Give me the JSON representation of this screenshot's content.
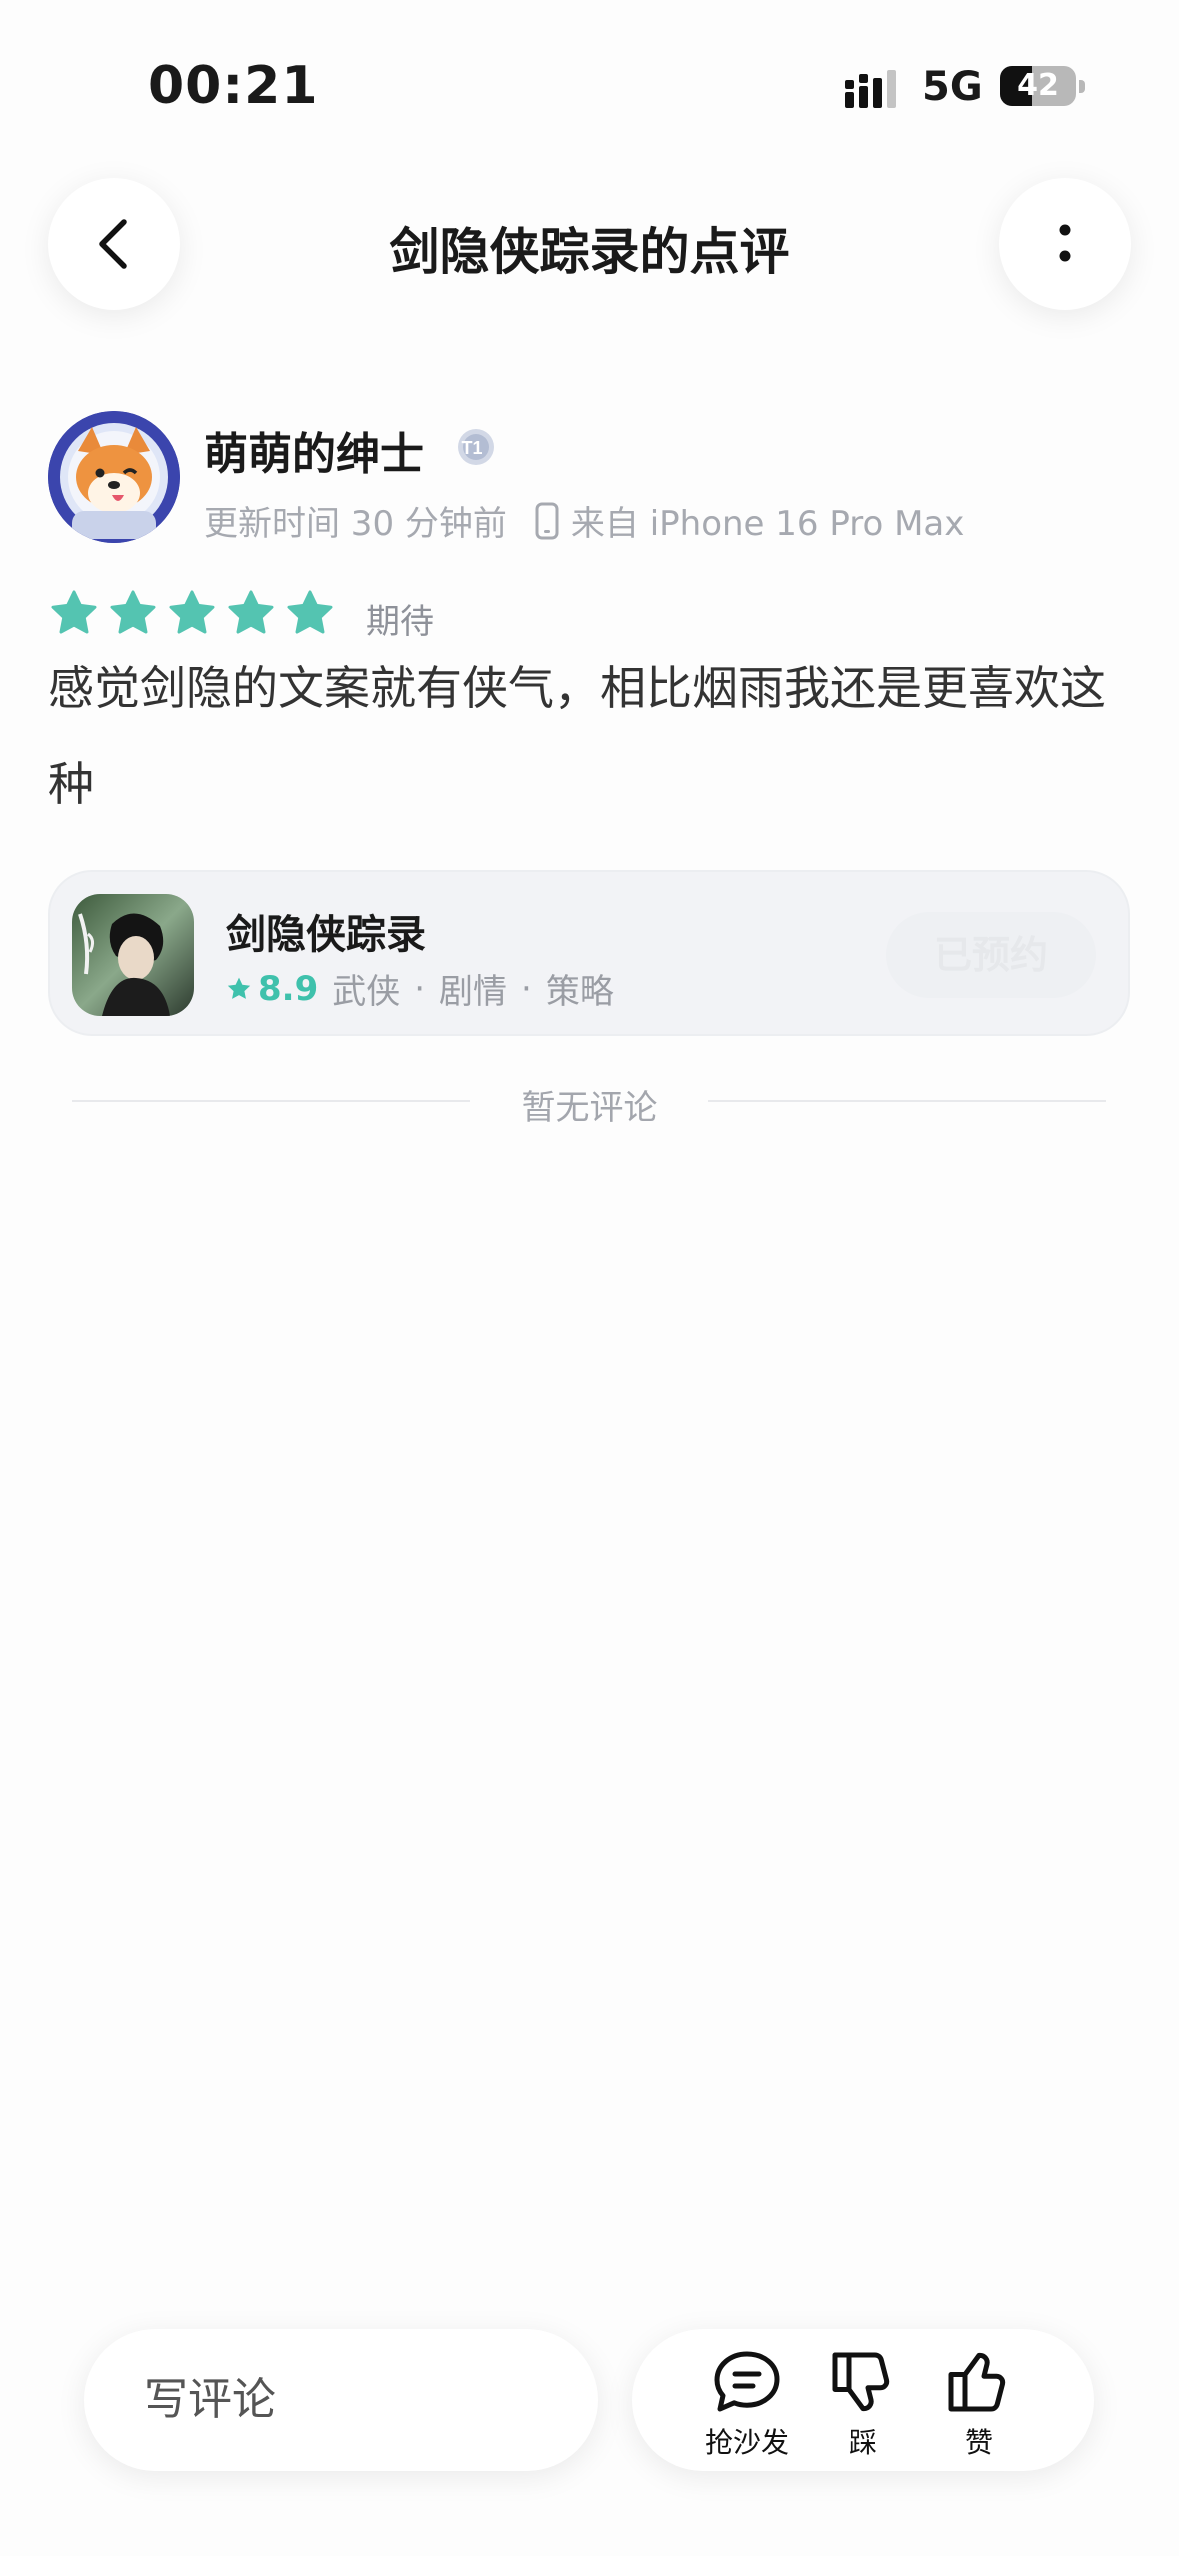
{
  "status_bar": {
    "time": "00:21",
    "network": "5G",
    "battery": "42",
    "battery_level": 0.42
  },
  "header": {
    "title": "剑隐侠踪录的点评",
    "back_icon": "chevron-left-icon",
    "more_icon": "more-vertical-icon"
  },
  "author": {
    "name": "萌萌的绅士",
    "level_badge": "T1",
    "updated": "更新时间 30 分钟前",
    "device": "来自 iPhone 16 Pro Max"
  },
  "rating": {
    "stars": 5,
    "label": "期待",
    "star_color": "#54c4b1"
  },
  "review": {
    "text": "感觉剑隐的文案就有侠气，相比烟雨我还是更喜欢这种"
  },
  "game_card": {
    "name": "剑隐侠踪录",
    "score": "8.9",
    "tags": [
      "武侠",
      "剧情",
      "策略"
    ],
    "separator": "·",
    "button": "已预约"
  },
  "comments": {
    "empty_text": "暂无评论"
  },
  "bottom_bar": {
    "input_placeholder": "写评论",
    "actions": [
      {
        "icon": "comment-bubble-icon",
        "label": "抢沙发"
      },
      {
        "icon": "thumbs-down-icon",
        "label": "踩"
      },
      {
        "icon": "thumbs-up-icon",
        "label": "赞"
      }
    ]
  }
}
